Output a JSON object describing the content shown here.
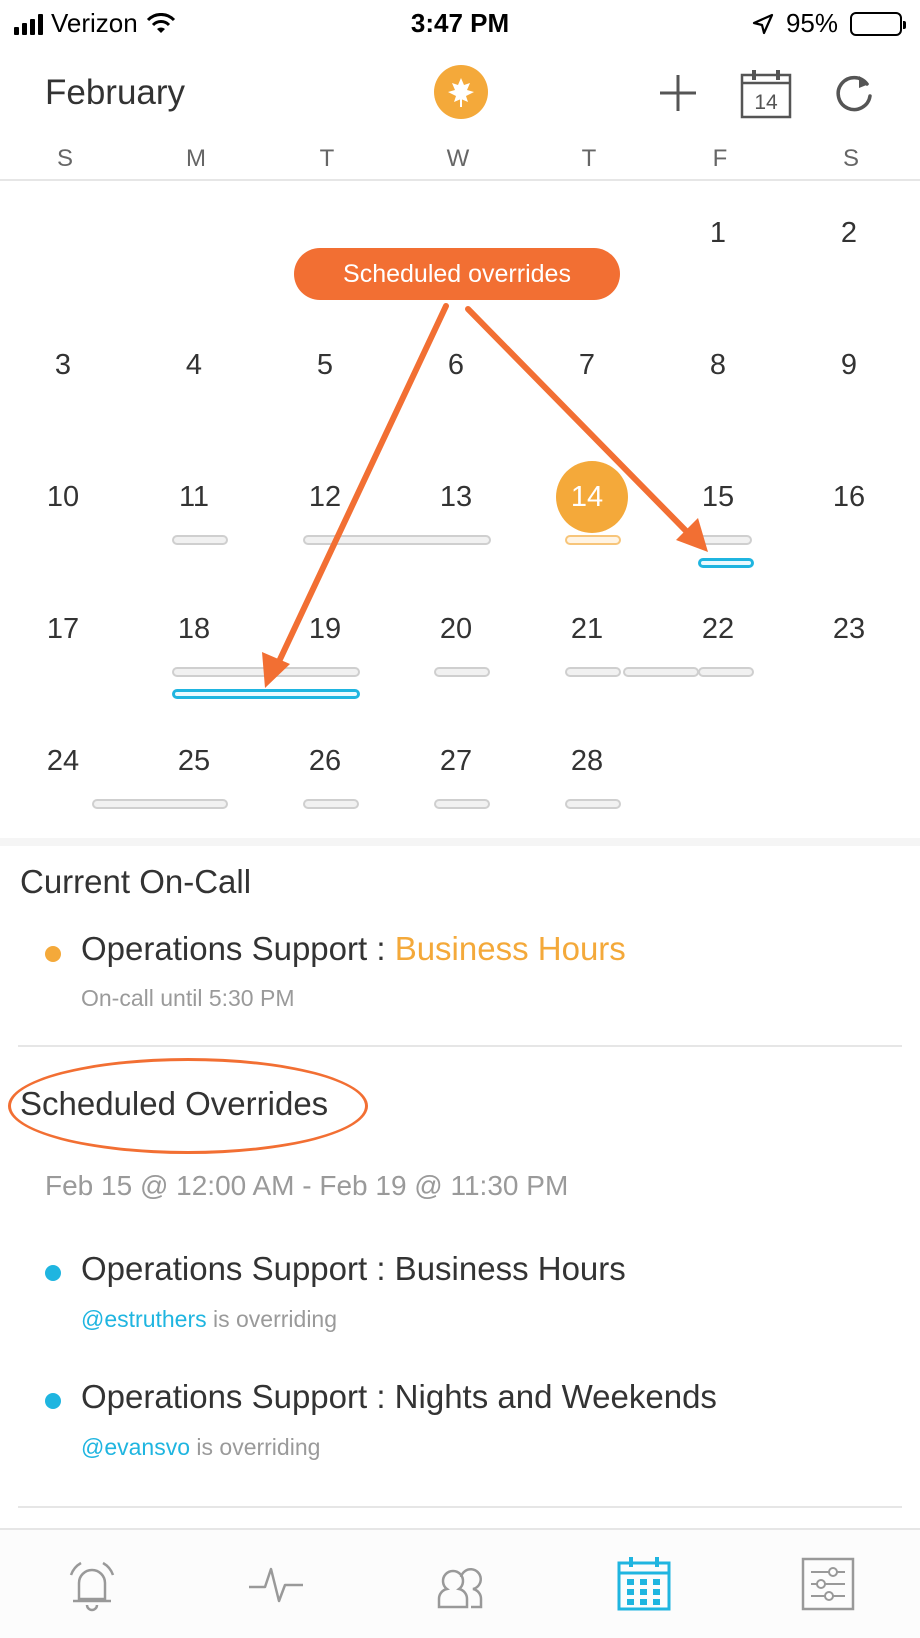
{
  "status_bar": {
    "carrier": "Verizon",
    "time": "3:47 PM",
    "battery": "95%",
    "battery_level": 0.95
  },
  "header": {
    "month": "February",
    "calendar_badge": "14",
    "icons": [
      "logo-leaf-icon",
      "add-icon",
      "calendar-today-icon",
      "refresh-icon"
    ]
  },
  "weekdays": [
    "S",
    "M",
    "T",
    "W",
    "T",
    "F",
    "S"
  ],
  "calendar": {
    "today": "14",
    "weeks": [
      [
        "",
        "",
        "",
        "",
        "",
        "1",
        "2"
      ],
      [
        "3",
        "4",
        "5",
        "6",
        "7",
        "8",
        "9"
      ],
      [
        "10",
        "11",
        "12",
        "13",
        "14",
        "15",
        "16"
      ],
      [
        "17",
        "18",
        "19",
        "20",
        "21",
        "22",
        "23"
      ],
      [
        "24",
        "25",
        "26",
        "27",
        "28",
        "",
        ""
      ]
    ]
  },
  "callout": {
    "label": "Scheduled overrides",
    "color": "#f26f33"
  },
  "current_oncall": {
    "title": "Current On-Call",
    "entry": {
      "team": "Operations Support : ",
      "schedule": "Business Hours",
      "sub": "On-call until 5:30 PM",
      "dot_color": "#f4a93a"
    }
  },
  "scheduled_overrides": {
    "title": "Scheduled Overrides",
    "range": "Feb 15 @ 12:00 AM - Feb 19 @ 11:30 PM",
    "items": [
      {
        "label": "Operations Support : Business Hours",
        "user": "@estruthers",
        "suffix": " is overriding",
        "dot_color": "#1fb5e0"
      },
      {
        "label": "Operations Support : Nights and Weekends",
        "user": "@evansvo",
        "suffix": " is overriding",
        "dot_color": "#1fb5e0"
      }
    ]
  },
  "tabbar": {
    "tabs": [
      "alerts-bell-icon",
      "activity-pulse-icon",
      "teams-people-icon",
      "calendar-grid-icon",
      "settings-sliders-icon"
    ],
    "active": "calendar-grid-icon",
    "active_color": "#1fb5e0"
  }
}
